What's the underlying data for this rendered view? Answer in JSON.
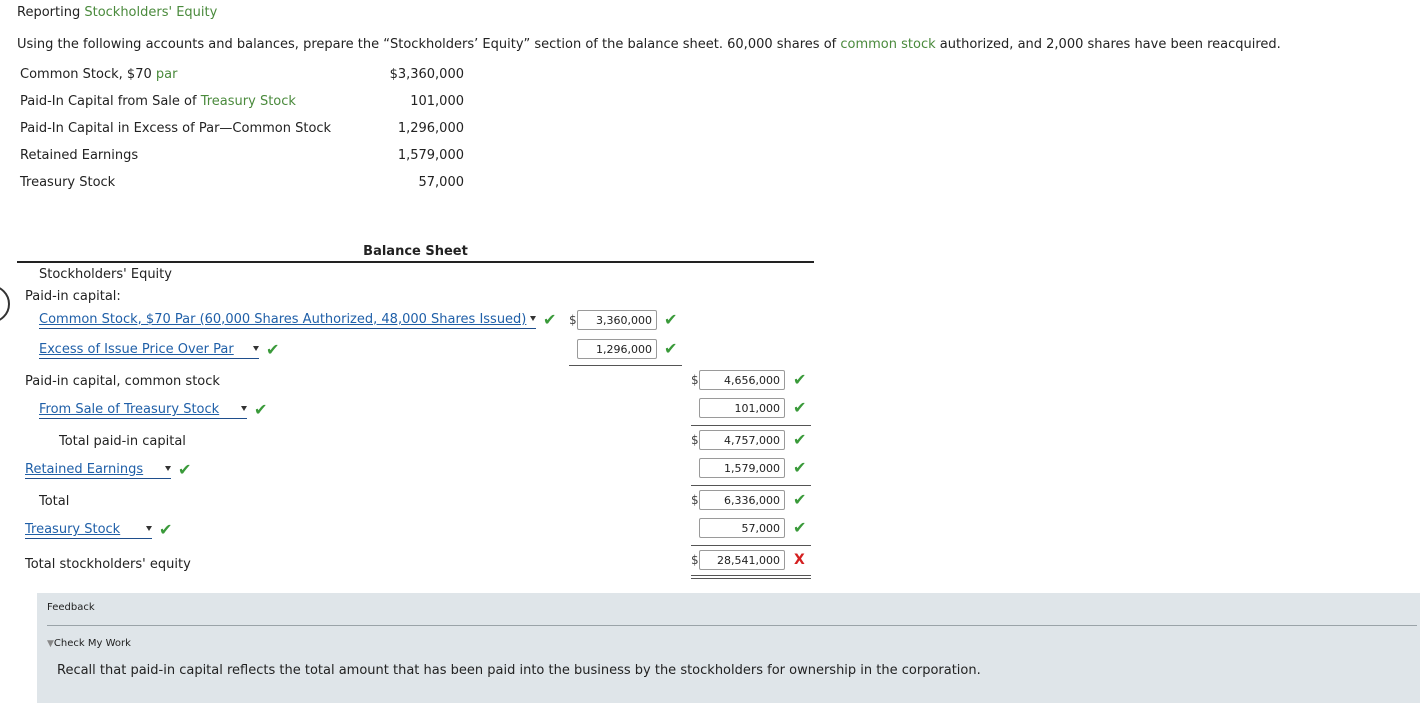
{
  "title": {
    "prefix": "Reporting ",
    "link": "Stockholders' Equity"
  },
  "instructions": {
    "part1": "Using the following accounts and balances, prepare the “Stockholders’ Equity” section of the balance sheet. 60,000 shares of ",
    "link": "common stock",
    "part2": " authorized, and 2,000 shares have been reacquired."
  },
  "accounts": [
    {
      "pre": "Common Stock, $70 ",
      "link": "par",
      "post": "",
      "value": "$3,360,000"
    },
    {
      "pre": "Paid-In Capital from Sale of ",
      "link": "Treasury Stock",
      "post": "",
      "value": "101,000"
    },
    {
      "pre": "Paid-In Capital in Excess of Par—Common Stock",
      "link": "",
      "post": "",
      "value": "1,296,000"
    },
    {
      "pre": "Retained Earnings",
      "link": "",
      "post": "",
      "value": "1,579,000"
    },
    {
      "pre": "Treasury Stock",
      "link": "",
      "post": "",
      "value": "57,000"
    }
  ],
  "sheet": {
    "title": "Balance Sheet",
    "section": "Stockholders' Equity",
    "paid_in_label": "Paid-in capital:",
    "dd_common": "Common Stock, $70 Par (60,000 Shares Authorized, 48,000 Shares Issued)",
    "dd_excess": "Excess of Issue Price Over Par",
    "dd_treasury_sale": "From Sale of Treasury Stock",
    "dd_retained": "Retained Earnings",
    "dd_treasury": "Treasury Stock",
    "paid_in_common_label": "Paid-in capital, common stock",
    "total_paid_in_label": "Total paid-in capital",
    "total_label": "Total",
    "total_equity_label": "Total stockholders' equity",
    "currency": "$",
    "v_common": "3,360,000",
    "v_excess": "1,296,000",
    "v_paid_in_common": "4,656,000",
    "v_treasury_sale": "101,000",
    "v_total_paid_in": "4,757,000",
    "v_retained": "1,579,000",
    "v_total": "6,336,000",
    "v_treasury": "57,000",
    "v_total_equity": "28,541,000",
    "check_mark": "✔",
    "x_mark": "X"
  },
  "feedback": {
    "heading": "Feedback",
    "toggle_icon": "▼",
    "check_label": "Check My Work",
    "text": "Recall that paid-in capital reflects the total amount that has been paid into the business by the stockholders for ownership in the corporation."
  },
  "colors": {
    "link_green": "#4a8a3c",
    "dropdown_blue": "#1f5fa8",
    "check_green": "#3a9a3a",
    "error_red": "#d42020",
    "feedback_bg": "#dfe5e9"
  }
}
